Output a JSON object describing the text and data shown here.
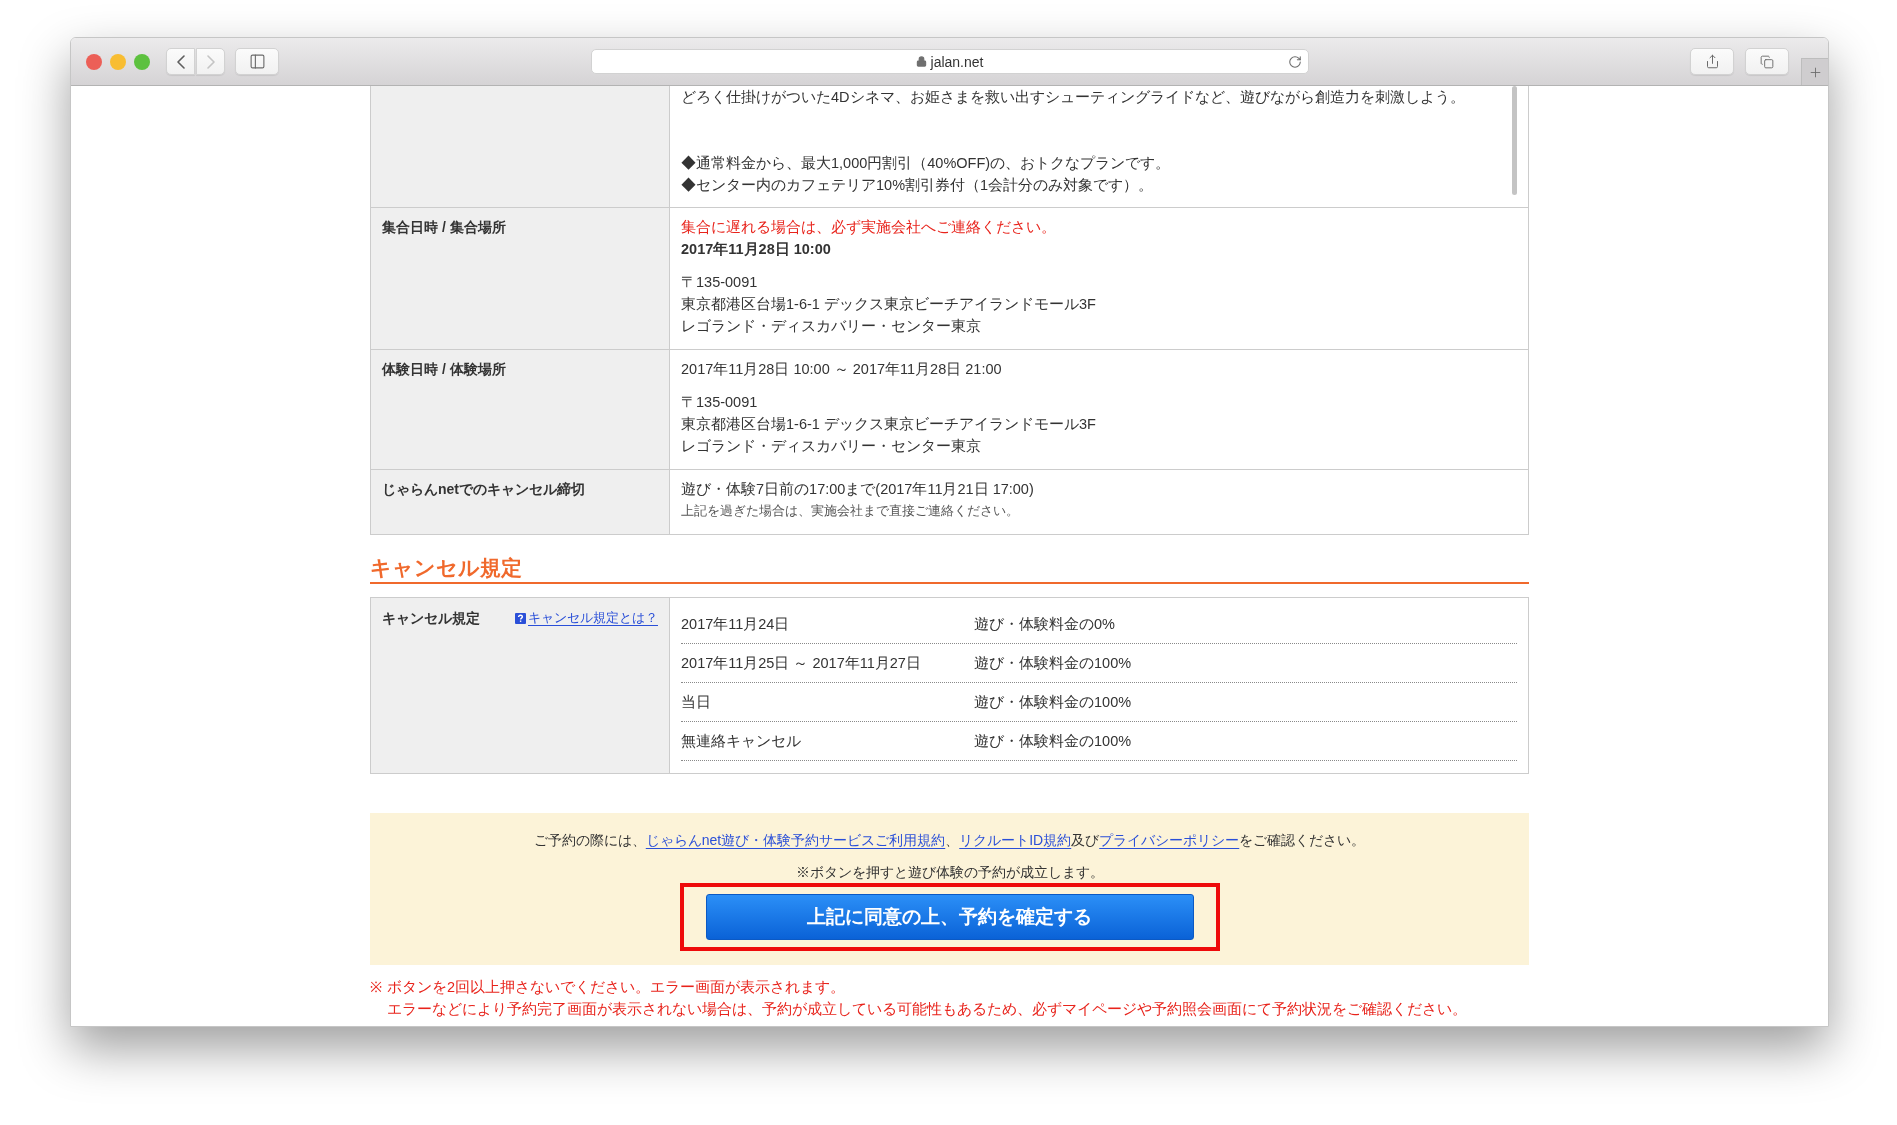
{
  "browser": {
    "url": "jalan.net",
    "secure": true,
    "navigation": [
      {
        "kind": "back",
        "disabled": false
      },
      {
        "kind": "forward",
        "disabled": true
      }
    ]
  },
  "details": {
    "rows": [
      {
        "kind": "scroll",
        "blocks": [
          [
            {
              "kind": "normal",
              "text": "どろく仕掛けがついた4Dシネマ、お姫さまを救い出すシューティングライドなど、遊びながら創造力を刺激しよう。"
            }
          ],
          [
            {
              "kind": "normal",
              "text": "◆通常料金から、最大1,000円割引（40%OFF)の、おトクなプランです。"
            },
            {
              "kind": "normal",
              "text": "◆センター内のカフェテリア10%割引券付（1会計分のみ対象です）。"
            }
          ]
        ]
      },
      {
        "kind": "info",
        "label": "集合日時 / 集合場所",
        "blocks": [
          [
            {
              "kind": "warning",
              "text": "集合に遅れる場合は、必ず実施会社へご連絡ください。"
            },
            {
              "kind": "strong",
              "text": "2017年11月28日 10:00"
            }
          ],
          [
            {
              "kind": "normal",
              "text": "〒135-0091"
            },
            {
              "kind": "normal",
              "text": "東京都港区台場1-6-1 デックス東京ビーチアイランドモール3F"
            },
            {
              "kind": "normal",
              "text": "レゴランド・ディスカバリー・センター東京"
            }
          ]
        ]
      },
      {
        "kind": "info",
        "label": "体験日時 / 体験場所",
        "blocks": [
          [
            {
              "kind": "normal",
              "text": "2017年11月28日 10:00 ～ 2017年11月28日 21:00"
            }
          ],
          [
            {
              "kind": "normal",
              "text": "〒135-0091"
            },
            {
              "kind": "normal",
              "text": "東京都港区台場1-6-1 デックス東京ビーチアイランドモール3F"
            },
            {
              "kind": "normal",
              "text": "レゴランド・ディスカバリー・センター東京"
            }
          ]
        ]
      },
      {
        "kind": "info",
        "label": "じゃらんnetでのキャンセル締切",
        "blocks": [
          [
            {
              "kind": "normal",
              "text": "遊び・体験7日前の17:00まで(2017年11月21日 17:00)"
            },
            {
              "kind": "small",
              "text": "上記を過ぎた場合は、実施会社まで直接ご連絡ください。"
            }
          ]
        ]
      }
    ]
  },
  "cancel_policy": {
    "heading": "キャンセル規定",
    "label": "キャンセル規定",
    "help_link": "キャンセル規定とは？",
    "rows": [
      {
        "period": "2017年11月24日",
        "charge": "遊び・体験料金の0%"
      },
      {
        "period": "2017年11月25日 ～ 2017年11月27日",
        "charge": "遊び・体験料金の100%"
      },
      {
        "period": "当日",
        "charge": "遊び・体験料金の100%"
      },
      {
        "period": "無連絡キャンセル",
        "charge": "遊び・体験料金の100%"
      }
    ]
  },
  "agreement": {
    "sentence": [
      {
        "kind": "text",
        "text": "ご予約の際には、"
      },
      {
        "kind": "link",
        "text": "じゃらんnet遊び・体験予約サービスご利用規約"
      },
      {
        "kind": "text",
        "text": "、"
      },
      {
        "kind": "link",
        "text": "リクルートID規約"
      },
      {
        "kind": "text",
        "text": "及び"
      },
      {
        "kind": "link",
        "text": "プライバシーポリシー"
      },
      {
        "kind": "text",
        "text": "をご確認ください。"
      }
    ],
    "notice": "※ボタンを押すと遊び体験の予約が成立します。",
    "confirm_button": {
      "label": "上記に同意の上、予約を確定する",
      "highlighted": true
    }
  },
  "warnings": [
    {
      "marker": "※",
      "lines": [
        "ボタンを2回以上押さないでください。エラー画面が表示されます。",
        "エラーなどにより予約完了画面が表示されない場合は、予約が成立している可能性もあるため、必ずマイページや予約照会画面にて予約状況をご確認ください。"
      ]
    }
  ]
}
